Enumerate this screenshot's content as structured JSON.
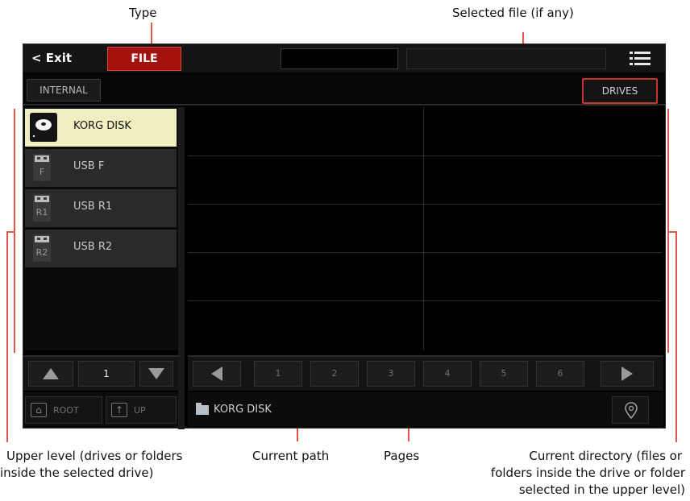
{
  "annotations": {
    "type": "Type",
    "selected_file": "Selected file (if any)",
    "upper_level_1": "Upper level (drives or folders",
    "upper_level_2": "inside the selected drive)",
    "current_path": "Current path",
    "pages": "Pages",
    "current_dir_1": "Current directory (files or",
    "current_dir_2": "folders inside the drive or folder",
    "current_dir_3": "selected in the upper level)"
  },
  "topbar": {
    "exit_label": "< Exit",
    "type_button": "FILE",
    "menu_icon": "list-menu-icon"
  },
  "tabs": {
    "internal": "INTERNAL",
    "drives": "DRIVES"
  },
  "drives": [
    {
      "label": "KORG DISK",
      "tag": "",
      "icon": "hard-disk-icon",
      "selected": true
    },
    {
      "label": "USB F",
      "tag": "F",
      "icon": "usb-icon",
      "selected": false
    },
    {
      "label": "USB R1",
      "tag": "R1",
      "icon": "usb-icon",
      "selected": false
    },
    {
      "label": "USB R2",
      "tag": "R2",
      "icon": "usb-icon",
      "selected": false
    }
  ],
  "left_pager": {
    "page": "1"
  },
  "pages": [
    "1",
    "2",
    "3",
    "4",
    "5",
    "6"
  ],
  "nav": {
    "root": "ROOT",
    "up": "UP"
  },
  "path": {
    "text": "KORG DISK"
  },
  "colors": {
    "accent_red": "#a3120f",
    "selected_row": "#f1efc2",
    "annotation_line": "#e4544a"
  }
}
